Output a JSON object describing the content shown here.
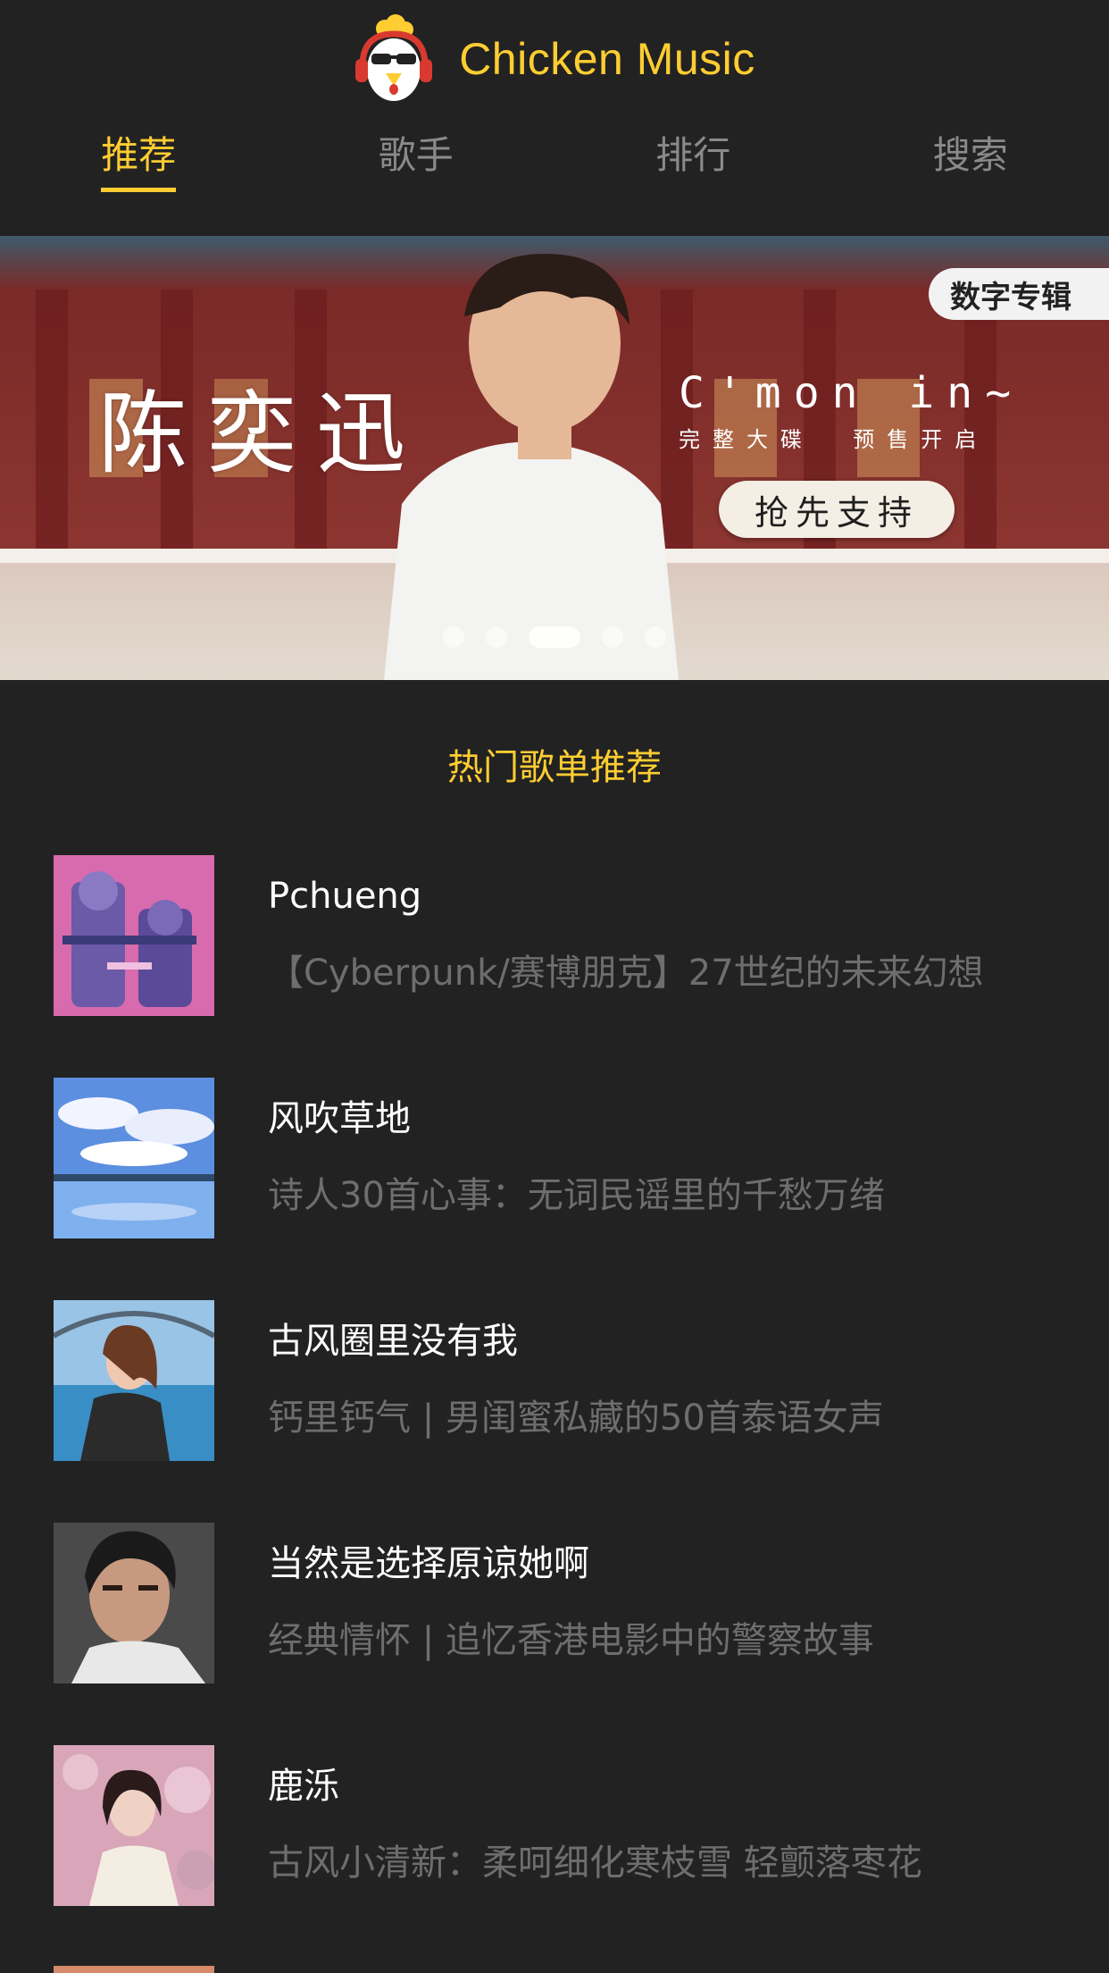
{
  "header": {
    "app_name": "Chicken Music",
    "logo_icon": "chicken-headphones-logo",
    "accent_color": "#ffcd32"
  },
  "tabs": [
    {
      "label": "推荐",
      "active": true
    },
    {
      "label": "歌手",
      "active": false
    },
    {
      "label": "排行",
      "active": false
    },
    {
      "label": "搜索",
      "active": false
    }
  ],
  "banner": {
    "artist": "陈奕迅",
    "album": "C'mon in~",
    "subtitle": "完整大碟  预售开启",
    "cta": "抢先支持",
    "badge": "数字专辑",
    "slide_count": 5,
    "active_slide": 2
  },
  "section": {
    "title": "热门歌单推荐"
  },
  "playlists": [
    {
      "name": "Pchueng",
      "desc": "【Cyberpunk/赛博朋克】27世纪的未来幻想",
      "thumb": "cyberpunk-robots-art"
    },
    {
      "name": "风吹草地",
      "desc": "诗人30首心事：无词民谣里的千愁万绪",
      "thumb": "blue-sky-lake-art"
    },
    {
      "name": "古风圈里没有我",
      "desc": "钙里钙气 | 男闺蜜私藏的50首泰语女声",
      "thumb": "girl-by-harbor-photo"
    },
    {
      "name": "当然是选择原谅她啊",
      "desc": "经典情怀 | 追忆香港电影中的警察故事",
      "thumb": "man-portrait-photo"
    },
    {
      "name": "鹿泺",
      "desc": "古风小清新：柔呵细化寒枝雪 轻颤落枣花",
      "thumb": "girl-in-blossoms-photo"
    }
  ]
}
